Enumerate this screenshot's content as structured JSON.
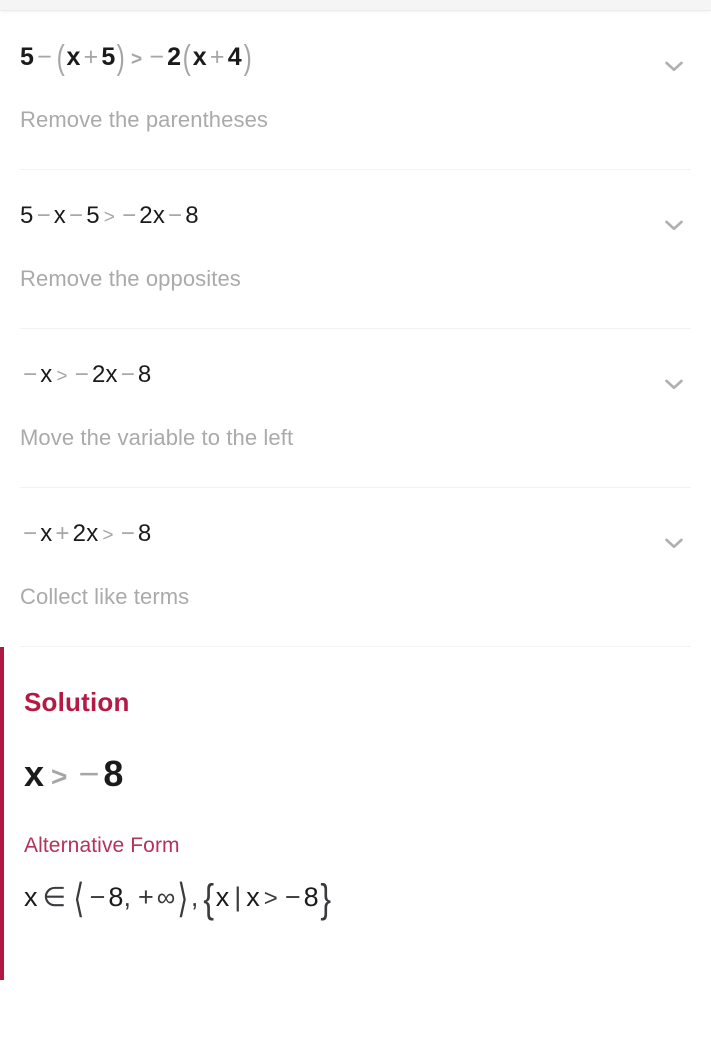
{
  "theme": {
    "accent": "#b51a45",
    "accent_bar": "#b01a42",
    "alt_title_color": "#b5325a",
    "math_black": "#1b1b1b",
    "math_gray": "#a6a6a6",
    "desc_gray": "#aaaaac",
    "divider": "#f2f2f4",
    "top_strip": "#f5f5f6",
    "background": "#ffffff"
  },
  "steps": [
    {
      "expression_text": "5 - (x + 5) > -2(x + 4)",
      "tokens": [
        {
          "t": "5",
          "k": "num"
        },
        {
          "t": "−",
          "k": "op"
        },
        {
          "t": "(",
          "k": "paren-l"
        },
        {
          "t": "x",
          "k": "var"
        },
        {
          "t": "+",
          "k": "op"
        },
        {
          "t": "5",
          "k": "num"
        },
        {
          "t": ")",
          "k": "paren-r"
        },
        {
          "t": ">",
          "k": "rel"
        },
        {
          "t": "−",
          "k": "op"
        },
        {
          "t": "2",
          "k": "num"
        },
        {
          "t": "(",
          "k": "paren-l"
        },
        {
          "t": "x",
          "k": "var"
        },
        {
          "t": "+",
          "k": "op"
        },
        {
          "t": "4",
          "k": "num"
        },
        {
          "t": ")",
          "k": "paren-r"
        }
      ],
      "description": "Remove the parentheses",
      "toggle_icon": "chevron-down-icon",
      "emphasis": "lead"
    },
    {
      "expression_text": "5 - x - 5 > -2x - 8",
      "tokens": [
        {
          "t": "5",
          "k": "num"
        },
        {
          "t": "−",
          "k": "op"
        },
        {
          "t": "x",
          "k": "var"
        },
        {
          "t": "−",
          "k": "op"
        },
        {
          "t": "5",
          "k": "num"
        },
        {
          "t": ">",
          "k": "rel"
        },
        {
          "t": "−",
          "k": "op"
        },
        {
          "t": "2",
          "k": "num"
        },
        {
          "t": "x",
          "k": "var"
        },
        {
          "t": "−",
          "k": "op"
        },
        {
          "t": "8",
          "k": "num"
        }
      ],
      "description": "Remove the opposites",
      "toggle_icon": "chevron-down-icon",
      "emphasis": "plain"
    },
    {
      "expression_text": "- x > -2x - 8",
      "tokens": [
        {
          "t": "−",
          "k": "op"
        },
        {
          "t": "x",
          "k": "var"
        },
        {
          "t": ">",
          "k": "rel"
        },
        {
          "t": "−",
          "k": "op"
        },
        {
          "t": "2",
          "k": "num"
        },
        {
          "t": "x",
          "k": "var"
        },
        {
          "t": "−",
          "k": "op"
        },
        {
          "t": "8",
          "k": "num"
        }
      ],
      "description": "Move the variable to the left",
      "toggle_icon": "chevron-down-icon",
      "emphasis": "plain"
    },
    {
      "expression_text": "- x + 2x > -8",
      "tokens": [
        {
          "t": "−",
          "k": "op"
        },
        {
          "t": "x",
          "k": "var"
        },
        {
          "t": "+",
          "k": "op"
        },
        {
          "t": "2",
          "k": "num"
        },
        {
          "t": "x",
          "k": "var"
        },
        {
          "t": ">",
          "k": "rel"
        },
        {
          "t": "−",
          "k": "op"
        },
        {
          "t": "8",
          "k": "num"
        }
      ],
      "description": "Collect like terms",
      "toggle_icon": "chevron-down-icon",
      "emphasis": "plain"
    }
  ],
  "solution": {
    "title": "Solution",
    "equation_text": "x > -8",
    "equation_tokens": [
      {
        "t": "x",
        "k": "var"
      },
      {
        "t": ">",
        "k": "rel"
      },
      {
        "t": "−",
        "k": "op"
      },
      {
        "t": "8",
        "k": "num"
      }
    ],
    "alternative_title": "Alternative Form",
    "alternative_text": "x ∈ ⟨-8, +∞⟩, {x | x > -8}",
    "alternative_tokens": [
      {
        "t": "x",
        "k": "var"
      },
      {
        "t": "∈",
        "k": "sym"
      },
      {
        "t": "⟨",
        "k": "abrk"
      },
      {
        "t": "−",
        "k": "op"
      },
      {
        "t": "8",
        "k": "num"
      },
      {
        "t": ",",
        "k": "comma"
      },
      {
        "t": "+",
        "k": "op"
      },
      {
        "t": "∞",
        "k": "inf"
      },
      {
        "t": "⟩",
        "k": "abrk"
      },
      {
        "t": ",",
        "k": "comma"
      },
      {
        "t": "{",
        "k": "cbrk"
      },
      {
        "t": "x",
        "k": "var"
      },
      {
        "t": "|",
        "k": "bar"
      },
      {
        "t": "x",
        "k": "var"
      },
      {
        "t": ">",
        "k": "rel"
      },
      {
        "t": "−",
        "k": "op"
      },
      {
        "t": "8",
        "k": "num"
      },
      {
        "t": "}",
        "k": "cbrk"
      }
    ]
  }
}
